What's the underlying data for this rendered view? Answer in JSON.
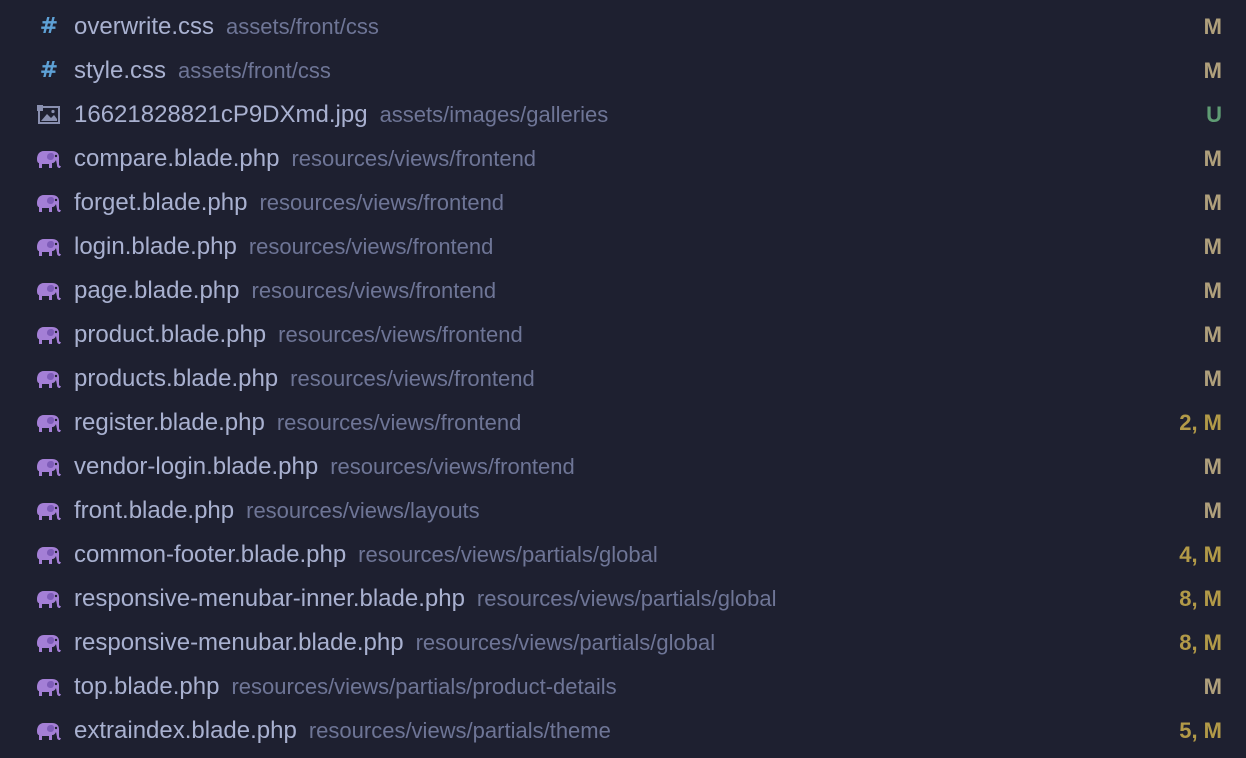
{
  "colors": {
    "background": "#1e2030",
    "file_name": "#a9b1d0",
    "file_path": "#6e7596",
    "css_icon": "#5ea1d6",
    "php_icon": "#a47fd6",
    "image_icon": "#8a90b0",
    "status_modified": "#b0a07c",
    "status_untracked": "#5f9c74",
    "status_numbered": "#b29a48"
  },
  "files": [
    {
      "icon": "css-hash-icon",
      "name": "overwrite.css",
      "path": "assets/front/css",
      "status": "M"
    },
    {
      "icon": "css-hash-icon",
      "name": "style.css",
      "path": "assets/front/css",
      "status": "M"
    },
    {
      "icon": "image-icon",
      "name": "16621828821cP9DXmd.jpg",
      "path": "assets/images/galleries",
      "status": "U"
    },
    {
      "icon": "php-elephant-icon",
      "name": "compare.blade.php",
      "path": "resources/views/frontend",
      "status": "M"
    },
    {
      "icon": "php-elephant-icon",
      "name": "forget.blade.php",
      "path": "resources/views/frontend",
      "status": "M"
    },
    {
      "icon": "php-elephant-icon",
      "name": "login.blade.php",
      "path": "resources/views/frontend",
      "status": "M"
    },
    {
      "icon": "php-elephant-icon",
      "name": "page.blade.php",
      "path": "resources/views/frontend",
      "status": "M"
    },
    {
      "icon": "php-elephant-icon",
      "name": "product.blade.php",
      "path": "resources/views/frontend",
      "status": "M"
    },
    {
      "icon": "php-elephant-icon",
      "name": "products.blade.php",
      "path": "resources/views/frontend",
      "status": "M"
    },
    {
      "icon": "php-elephant-icon",
      "name": "register.blade.php",
      "path": "resources/views/frontend",
      "status": "2, M"
    },
    {
      "icon": "php-elephant-icon",
      "name": "vendor-login.blade.php",
      "path": "resources/views/frontend",
      "status": "M"
    },
    {
      "icon": "php-elephant-icon",
      "name": "front.blade.php",
      "path": "resources/views/layouts",
      "status": "M"
    },
    {
      "icon": "php-elephant-icon",
      "name": "common-footer.blade.php",
      "path": "resources/views/partials/global",
      "status": "4, M"
    },
    {
      "icon": "php-elephant-icon",
      "name": "responsive-menubar-inner.blade.php",
      "path": "resources/views/partials/global",
      "status": "8, M"
    },
    {
      "icon": "php-elephant-icon",
      "name": "responsive-menubar.blade.php",
      "path": "resources/views/partials/global",
      "status": "8, M"
    },
    {
      "icon": "php-elephant-icon",
      "name": "top.blade.php",
      "path": "resources/views/partials/product-details",
      "status": "M"
    },
    {
      "icon": "php-elephant-icon",
      "name": "extraindex.blade.php",
      "path": "resources/views/partials/theme",
      "status": "5, M"
    }
  ]
}
